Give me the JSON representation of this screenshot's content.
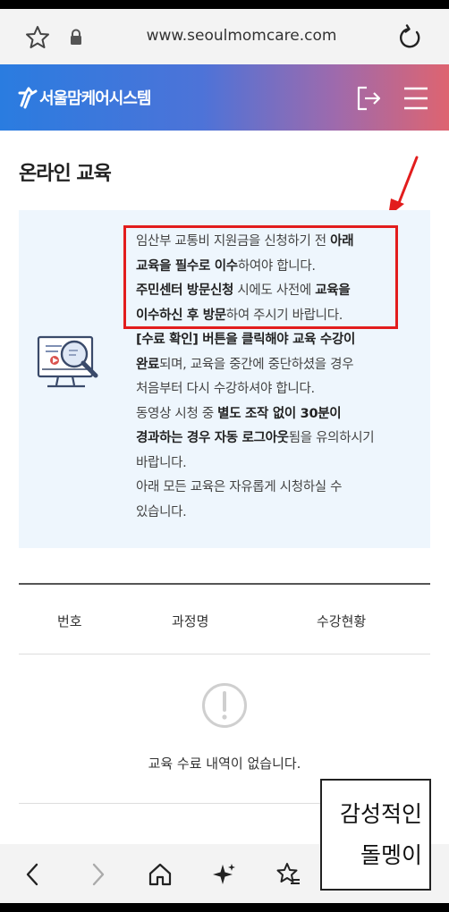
{
  "browser": {
    "url": "www.seoulmomcare.com",
    "icons": [
      "star-icon",
      "lock-icon",
      "reload-icon"
    ]
  },
  "header": {
    "logo_text": "서울맘케어시스템",
    "icons": [
      "logo-icon",
      "logout-icon",
      "menu-icon"
    ],
    "gradient": [
      "#2a7ce0",
      "#4d73d8",
      "#9f6aac",
      "#de6470"
    ]
  },
  "page": {
    "title": "온라인 교육"
  },
  "notice": {
    "background": "#eef6fd",
    "highlight_color": "#e21d1d",
    "lines": [
      [
        "임산부 교통비 지원금을 신청하기 전 ",
        "아래"
      ],
      [
        "교육을 필수로 이수",
        "하여야 합니다."
      ],
      [
        "주민센터 방문신청",
        " 시에도 사전에 ",
        "교육을"
      ],
      [
        "이수하신 후 방문",
        "하여 주시기 바랍니다."
      ],
      [
        "[수료 확인] 버튼을 클릭해야 교육 수강이"
      ],
      [
        "완료",
        "되며, 교육을 중간에 중단하셨을 경우"
      ],
      [
        "처음부터 다시 수강하셔야 합니다."
      ],
      [
        "동영상 시청 중 ",
        "별도 조작 없이 30분이"
      ],
      [
        "경과하는 경우 자동 로그아웃",
        "됨을 유의하시기"
      ],
      [
        "바랍니다."
      ],
      [
        "아래 모든 교육은 자유롭게 시청하실 수"
      ],
      [
        "있습니다."
      ]
    ]
  },
  "table": {
    "columns": [
      "번호",
      "과정명",
      "수강현황"
    ],
    "empty_message": "교육 수료 내역이 없습니다."
  },
  "bottom_nav": {
    "icons": [
      "back-icon",
      "forward-icon",
      "home-icon",
      "sparkle-icon",
      "bookmarks-icon"
    ]
  },
  "watermark": {
    "line1": "감성적인",
    "line2": "돌멩이"
  }
}
